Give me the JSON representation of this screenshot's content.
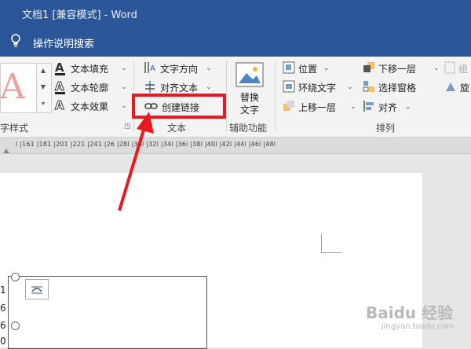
{
  "title_bar": {
    "title": "文档1 [兼容模式] - Word"
  },
  "tell_me": {
    "icon": "lightbulb-icon",
    "text": "操作说明搜索"
  },
  "ribbon": {
    "styles_group": {
      "label": "字样式"
    },
    "wordart_buttons": [
      {
        "label": "文本填充",
        "icon": "text-fill-icon"
      },
      {
        "label": "文本轮廓",
        "icon": "text-outline-icon"
      },
      {
        "label": "文本效果",
        "icon": "text-effects-icon"
      }
    ],
    "text_group": {
      "label": "文本",
      "buttons": [
        {
          "label": "文字方向",
          "icon": "text-direction-icon"
        },
        {
          "label": "对齐文本",
          "icon": "align-text-icon"
        },
        {
          "label": "创建链接",
          "icon": "link-icon"
        }
      ]
    },
    "accessibility_group": {
      "label": "辅助功能",
      "alt_text_line1": "替换",
      "alt_text_line2": "文字"
    },
    "arrange_group": {
      "label": "排列",
      "buttons": [
        {
          "label": "位置",
          "icon": "position-icon"
        },
        {
          "label": "环绕文字",
          "icon": "wrap-text-icon"
        },
        {
          "label": "上移一层",
          "icon": "bring-forward-icon"
        },
        {
          "label": "下移一层",
          "icon": "send-backward-icon"
        },
        {
          "label": "选择窗格",
          "icon": "selection-pane-icon"
        },
        {
          "label": "对齐",
          "icon": "align-icon"
        },
        {
          "label": "组",
          "icon": "group-icon"
        },
        {
          "label": "旋",
          "icon": "rotate-icon"
        }
      ]
    }
  },
  "ruler": {
    "labels": "l  |161  |181  |201  |221  |241  |26  |28l  |30l  |32l  |34l  |36l  |38l  |40l  |42l  |44l  |46l  |48l"
  },
  "document": {
    "side_numbers": [
      "1",
      "6",
      "6",
      "0"
    ]
  },
  "watermark": {
    "text": "Baidu 经验",
    "sub": "jingyan.baidu.com"
  },
  "colors": {
    "title_bar": "#2b579a",
    "highlight": "#e8191f",
    "ribbon_bg": "#f3f3f3"
  }
}
